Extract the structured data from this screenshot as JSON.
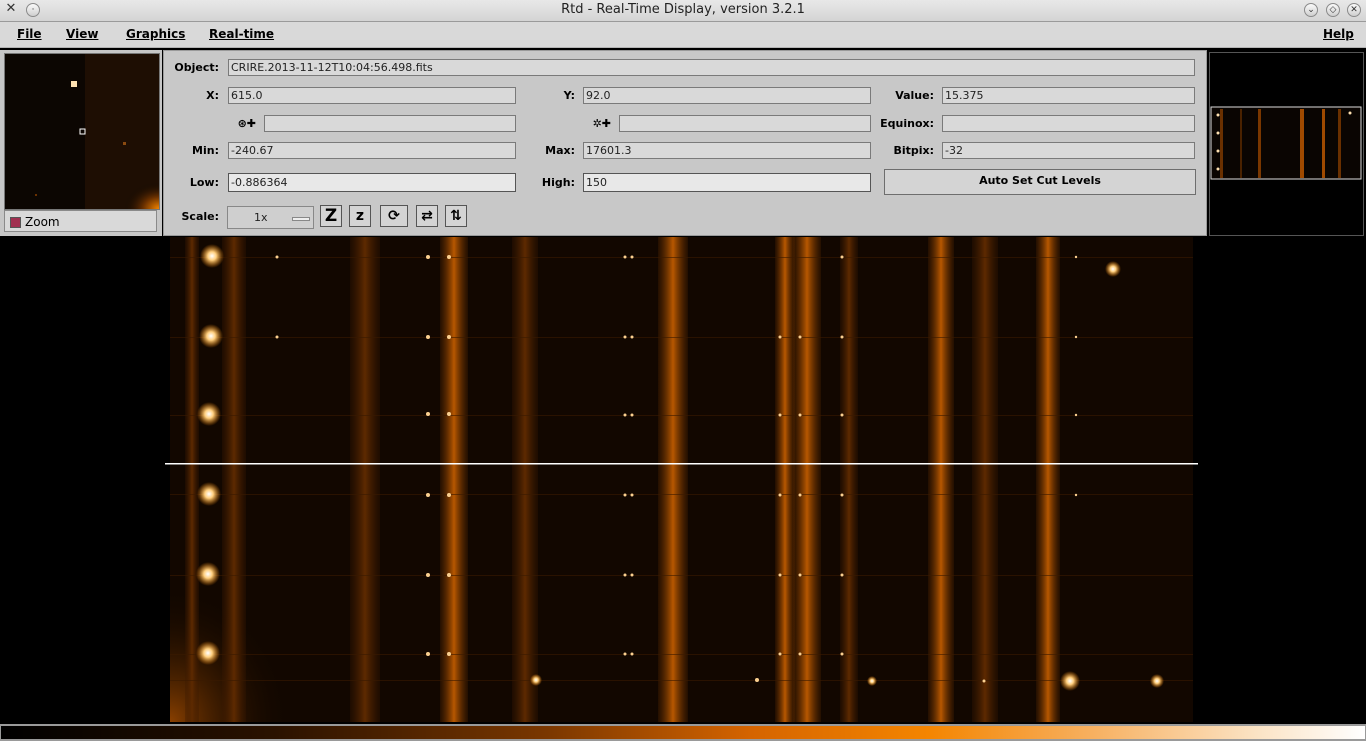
{
  "window": {
    "title": "Rtd - Real-Time Display, version 3.2.1"
  },
  "menubar": {
    "items": [
      "File",
      "View",
      "Graphics",
      "Real-time",
      "Help"
    ]
  },
  "zoom": {
    "button_label": "Zoom"
  },
  "info": {
    "object_label": "Object:",
    "object_value": "CRIRE.2013-11-12T10:04:56.498.fits",
    "x_label": "X:",
    "x_value": "615.0",
    "y_label": "Y:",
    "y_value": "92.0",
    "value_label": "Value:",
    "value_value": "15.375",
    "ra_icon": "ra-crosshair-icon",
    "ra_value": "",
    "dec_icon": "dec-crosshair-icon",
    "dec_value": "",
    "equinox_label": "Equinox:",
    "equinox_value": "",
    "min_label": "Min:",
    "min_value": "-240.67",
    "max_label": "Max:",
    "max_value": "17601.3",
    "bitpix_label": "Bitpix:",
    "bitpix_value": "-32",
    "low_label": "Low:",
    "low_value": "-0.886364",
    "high_label": "High:",
    "high_value": "150",
    "auto_cut_label": "Auto Set Cut Levels",
    "scale_label": "Scale:",
    "scale_value": "1x"
  },
  "toolbar": {
    "zoom_in_glyph": "Z",
    "zoom_out_glyph": "z",
    "rotate_glyph": "⟳",
    "flip_x_glyph": "⇄",
    "flip_y_glyph": "⇅"
  },
  "colors": {
    "panel_bg": "#c8c8c8",
    "image_orange": "#f48500",
    "crosshair": "#ffffff"
  }
}
